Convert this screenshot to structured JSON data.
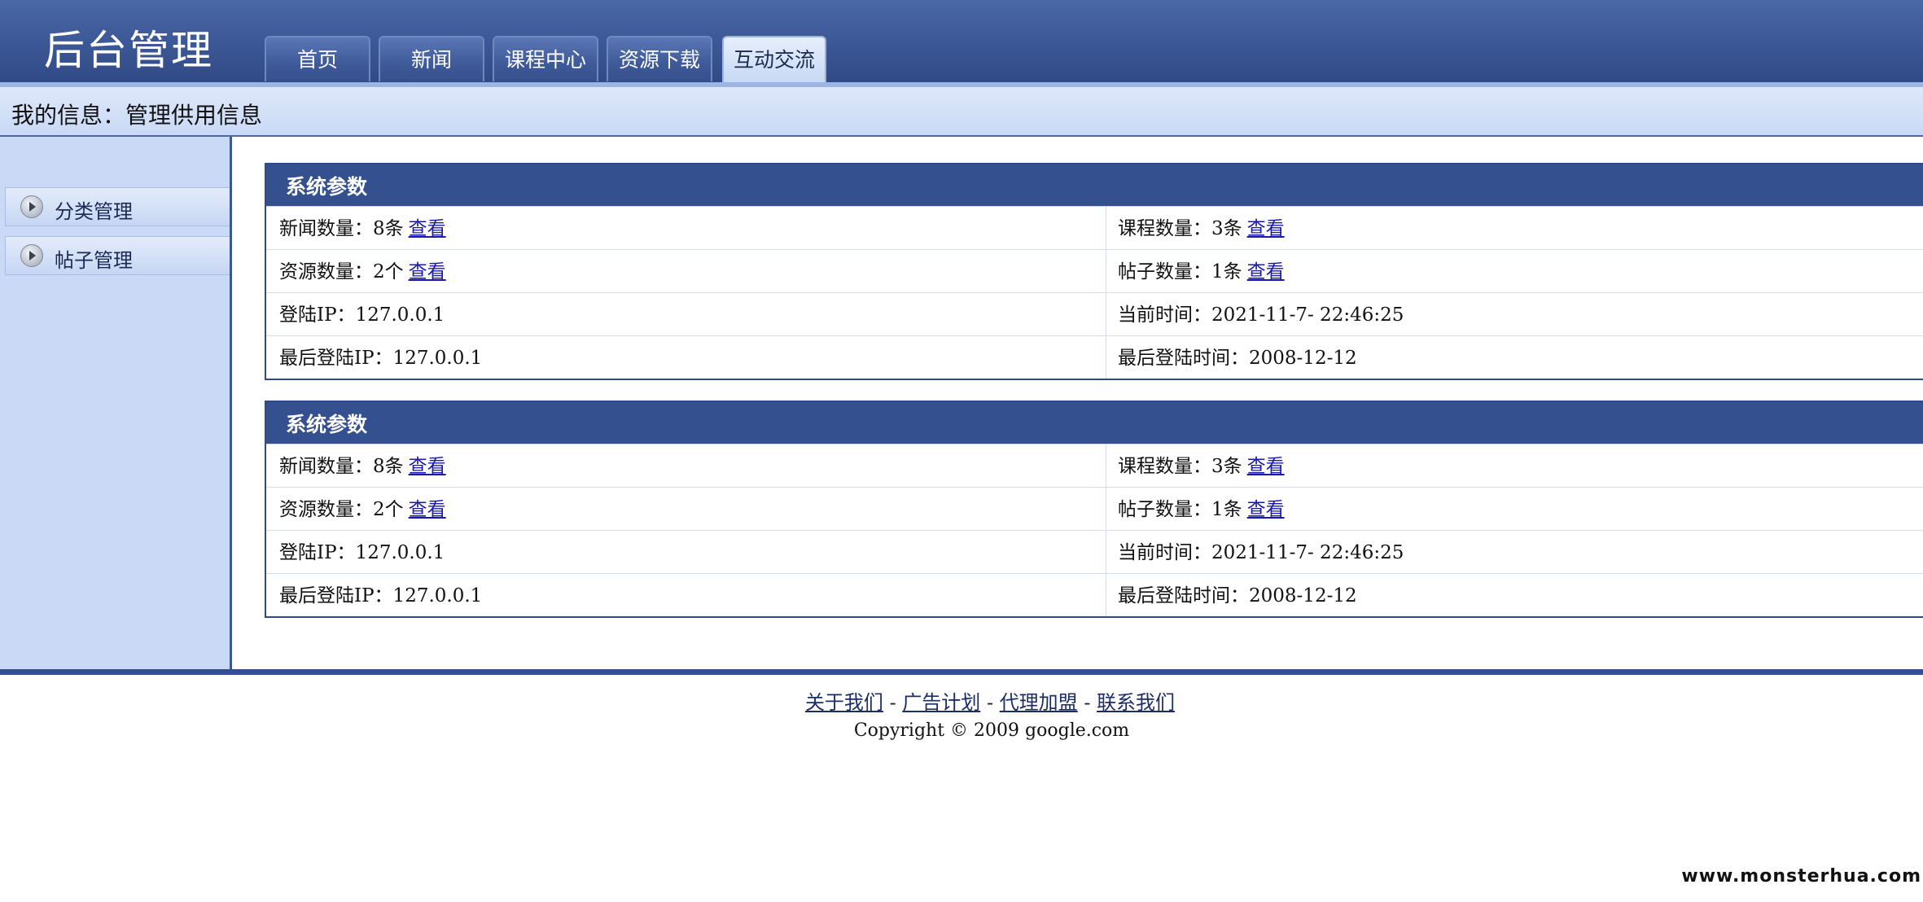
{
  "header": {
    "title": "后台管理",
    "tabs": [
      {
        "label": "首页"
      },
      {
        "label": "新闻"
      },
      {
        "label": "课程中心"
      },
      {
        "label": "资源下载"
      },
      {
        "label": "互动交流",
        "active": true
      }
    ]
  },
  "infobar": {
    "text": "我的信息：管理供用信息"
  },
  "sidebar": {
    "items": [
      {
        "label": "分类管理"
      },
      {
        "label": "帖子管理"
      }
    ]
  },
  "panels": [
    {
      "title": "系统参数",
      "rows": [
        {
          "left": "新闻数量：8条",
          "left_link": "查看",
          "right": "课程数量：3条",
          "right_link": "查看"
        },
        {
          "left": "资源数量：2个",
          "left_link": "查看",
          "right": "帖子数量：1条",
          "right_link": "查看"
        },
        {
          "left": "登陆IP：127.0.0.1",
          "right": "当前时间：2021-11-7- 22:46:25"
        },
        {
          "left": "最后登陆IP：127.0.0.1",
          "right": "最后登陆时间：2008-12-12"
        }
      ]
    },
    {
      "title": "系统参数",
      "rows": [
        {
          "left": "新闻数量：8条",
          "left_link": "查看",
          "right": "课程数量：3条",
          "right_link": "查看"
        },
        {
          "left": "资源数量：2个",
          "left_link": "查看",
          "right": "帖子数量：1条",
          "right_link": "查看"
        },
        {
          "left": "登陆IP：127.0.0.1",
          "right": "当前时间：2021-11-7- 22:46:25"
        },
        {
          "left": "最后登陆IP：127.0.0.1",
          "right": "最后登陆时间：2008-12-12"
        }
      ]
    }
  ],
  "footer": {
    "links": [
      "关于我们",
      "广告计划",
      "代理加盟",
      "联系我们"
    ],
    "separator": " - ",
    "copyright": "Copyright © 2009 google.com"
  },
  "watermark": "www.monsterhua.com",
  "colors": {
    "header_bg": "#3c5795",
    "panel_head": "#34508e",
    "sidebar_bg": "#cad9f5",
    "link": "#1a1aaa"
  }
}
